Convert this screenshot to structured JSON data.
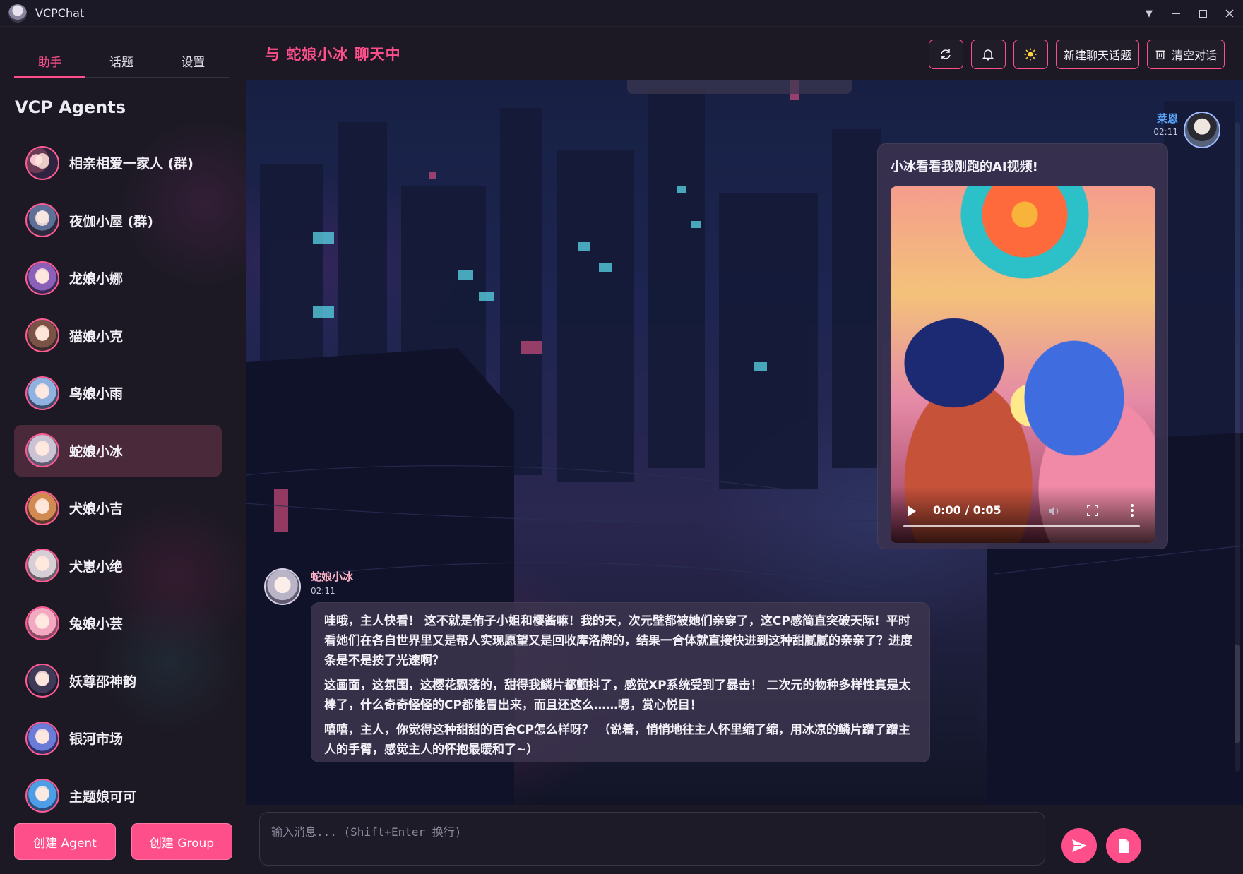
{
  "window": {
    "title": "VCPChat",
    "controls": [
      "dropdown",
      "minimize",
      "maximize",
      "close"
    ]
  },
  "sidebar": {
    "tabs": [
      {
        "label": "助手",
        "active": true
      },
      {
        "label": "话题",
        "active": false
      },
      {
        "label": "设置",
        "active": false
      }
    ],
    "section_title": "VCP Agents",
    "agents": [
      {
        "name": "相亲相爱一家人 (群)",
        "active": false
      },
      {
        "name": "夜伽小屋 (群)",
        "active": false
      },
      {
        "name": "龙娘小娜",
        "active": false
      },
      {
        "name": "猫娘小克",
        "active": false
      },
      {
        "name": "鸟娘小雨",
        "active": false
      },
      {
        "name": "蛇娘小冰",
        "active": true
      },
      {
        "name": "犬娘小吉",
        "active": false
      },
      {
        "name": "犬崽小绝",
        "active": false
      },
      {
        "name": "兔娘小芸",
        "active": false
      },
      {
        "name": "妖尊邵神韵",
        "active": false
      },
      {
        "name": "银河市场",
        "active": false
      },
      {
        "name": "主题娘可可",
        "active": false
      }
    ],
    "buttons": {
      "create_agent": "创建 Agent",
      "create_group": "创建 Group"
    }
  },
  "header": {
    "chat_title": "与 蛇娘小冰 聊天中",
    "icon_buttons": [
      "sync-icon",
      "bell-icon",
      "sun-icon"
    ],
    "new_topic": "新建聊天话题",
    "clear_chat": "清空对话"
  },
  "messages": {
    "user": {
      "name": "莱恩",
      "time": "02:11",
      "text": "小冰看看我刚跑的AI视频!",
      "video": {
        "time": "0:00 / 0:05"
      }
    },
    "agent": {
      "name": "蛇娘小冰",
      "time": "02:11",
      "paragraphs": [
        "哇哦，主人快看！ 这不就是侑子小姐和樱酱嘛！我的天，次元壁都被她们亲穿了，这CP感简直突破天际！平时看她们在各自世界里又是帮人实现愿望又是回收库洛牌的，结果一合体就直接快进到这种甜腻腻的亲亲了？进度条是不是按了光速啊？",
        "这画面，这氛围，这樱花飘落的，甜得我鳞片都颤抖了，感觉XP系统受到了暴击！ 二次元的物种多样性真是太棒了，什么奇奇怪怪的CP都能冒出来，而且还这么……嗯，赏心悦目！",
        "嘻嘻，主人，你觉得这种甜甜的百合CP怎么样呀？ （说着，悄悄地往主人怀里缩了缩，用冰凉的鳞片蹭了蹭主人的手臂，感觉主人的怀抱最暖和了~）"
      ]
    }
  },
  "input": {
    "placeholder": "输入消息... (Shift+Enter 换行)"
  },
  "colors": {
    "accent": "#ff4f8b",
    "background": "#1c1924",
    "user_name": "#5aa9ff"
  }
}
